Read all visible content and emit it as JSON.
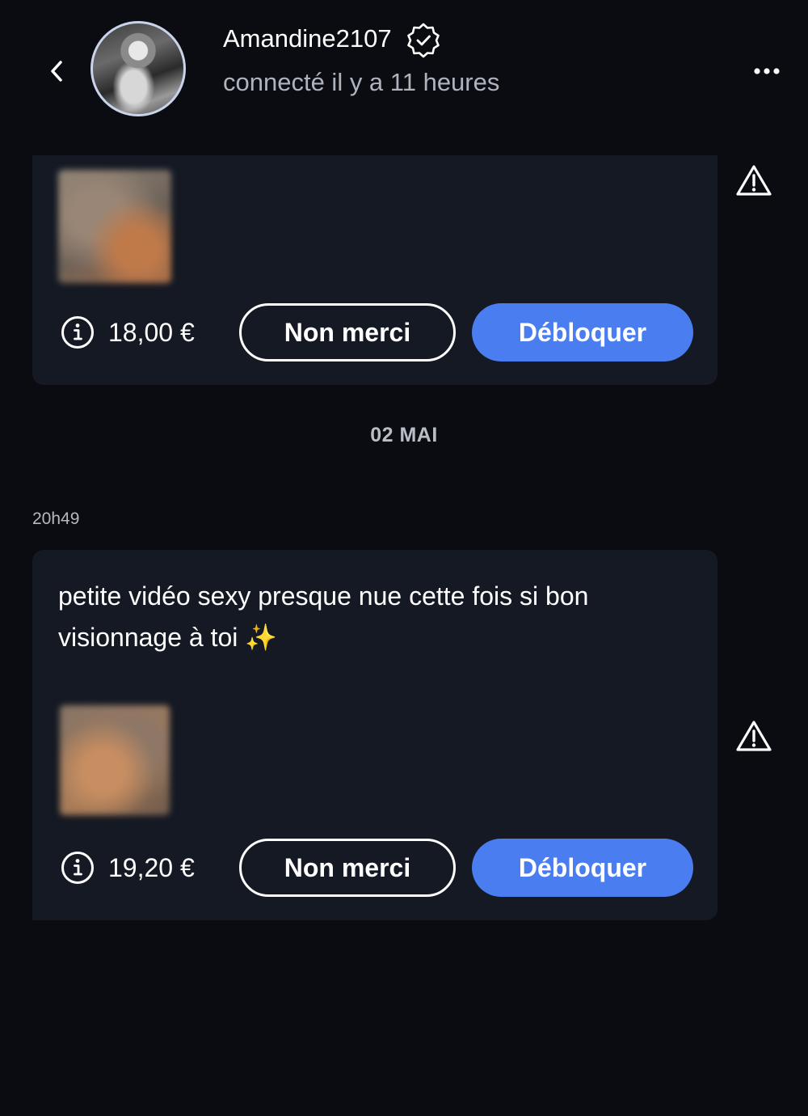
{
  "header": {
    "back_icon": "chevron-left-icon",
    "username": "Amandine2107",
    "verified_icon": "verified-badge-icon",
    "status": "connecté il y a 11 heures",
    "more_icon": "more-horizontal-icon"
  },
  "messages": [
    {
      "price": "18,00 €",
      "decline_label": "Non merci",
      "unlock_label": "Débloquer",
      "warning_icon": "warning-triangle-icon"
    },
    {
      "time": "20h49",
      "text": "petite vidéo sexy presque nue cette fois si bon visionnage à toi ✨",
      "price": "19,20 €",
      "decline_label": "Non merci",
      "unlock_label": "Débloquer",
      "warning_icon": "warning-triangle-icon"
    }
  ],
  "date_separator": "02 MAI",
  "colors": {
    "background": "#0a0c12",
    "bubble": "#141923",
    "accent": "#4a7ef0",
    "muted_text": "#aeb3bd"
  }
}
